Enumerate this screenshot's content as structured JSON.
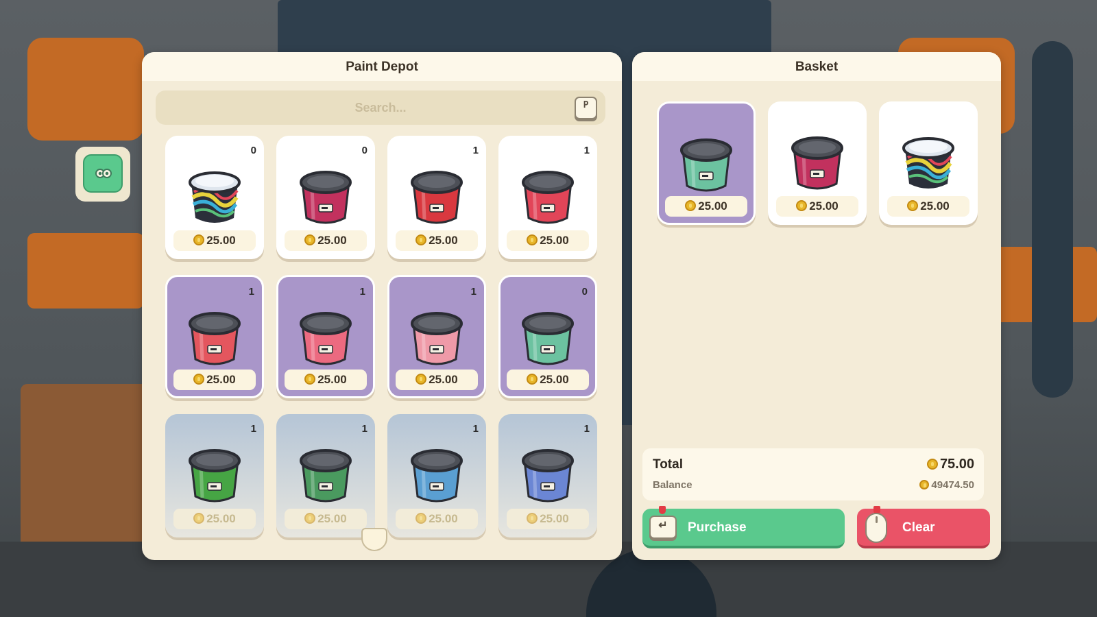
{
  "depot": {
    "title": "Paint Depot",
    "search_placeholder": "Search...",
    "search_key": "P",
    "items": [
      {
        "qty": "0",
        "price": "25.00",
        "style": "white",
        "color": "rainbow"
      },
      {
        "qty": "0",
        "price": "25.00",
        "style": "white",
        "color": "#c2315e"
      },
      {
        "qty": "1",
        "price": "25.00",
        "style": "white",
        "color": "#d9383f"
      },
      {
        "qty": "1",
        "price": "25.00",
        "style": "white",
        "color": "#e24558"
      },
      {
        "qty": "1",
        "price": "25.00",
        "style": "purple",
        "color": "#e4565e"
      },
      {
        "qty": "1",
        "price": "25.00",
        "style": "purple",
        "color": "#ec6a80"
      },
      {
        "qty": "1",
        "price": "25.00",
        "style": "purple",
        "color": "#ef9aa8"
      },
      {
        "qty": "0",
        "price": "25.00",
        "style": "purple",
        "color": "#6cc2a0"
      },
      {
        "qty": "1",
        "price": "25.00",
        "style": "blue",
        "color": "#46a544"
      },
      {
        "qty": "1",
        "price": "25.00",
        "style": "blue",
        "color": "#4a9a5f"
      },
      {
        "qty": "1",
        "price": "25.00",
        "style": "blue",
        "color": "#5a9fd2"
      },
      {
        "qty": "1",
        "price": "25.00",
        "style": "blue",
        "color": "#6b86d4"
      }
    ]
  },
  "basket": {
    "title": "Basket",
    "items": [
      {
        "price": "25.00",
        "style": "purple",
        "color": "#6cc2a0"
      },
      {
        "price": "25.00",
        "style": "white",
        "color": "#c2315e"
      },
      {
        "price": "25.00",
        "style": "white",
        "color": "rainbow"
      }
    ],
    "total_label": "Total",
    "total_value": "75.00",
    "balance_label": "Balance",
    "balance_value": "49474.50",
    "purchase_label": "Purchase",
    "clear_label": "Clear"
  }
}
